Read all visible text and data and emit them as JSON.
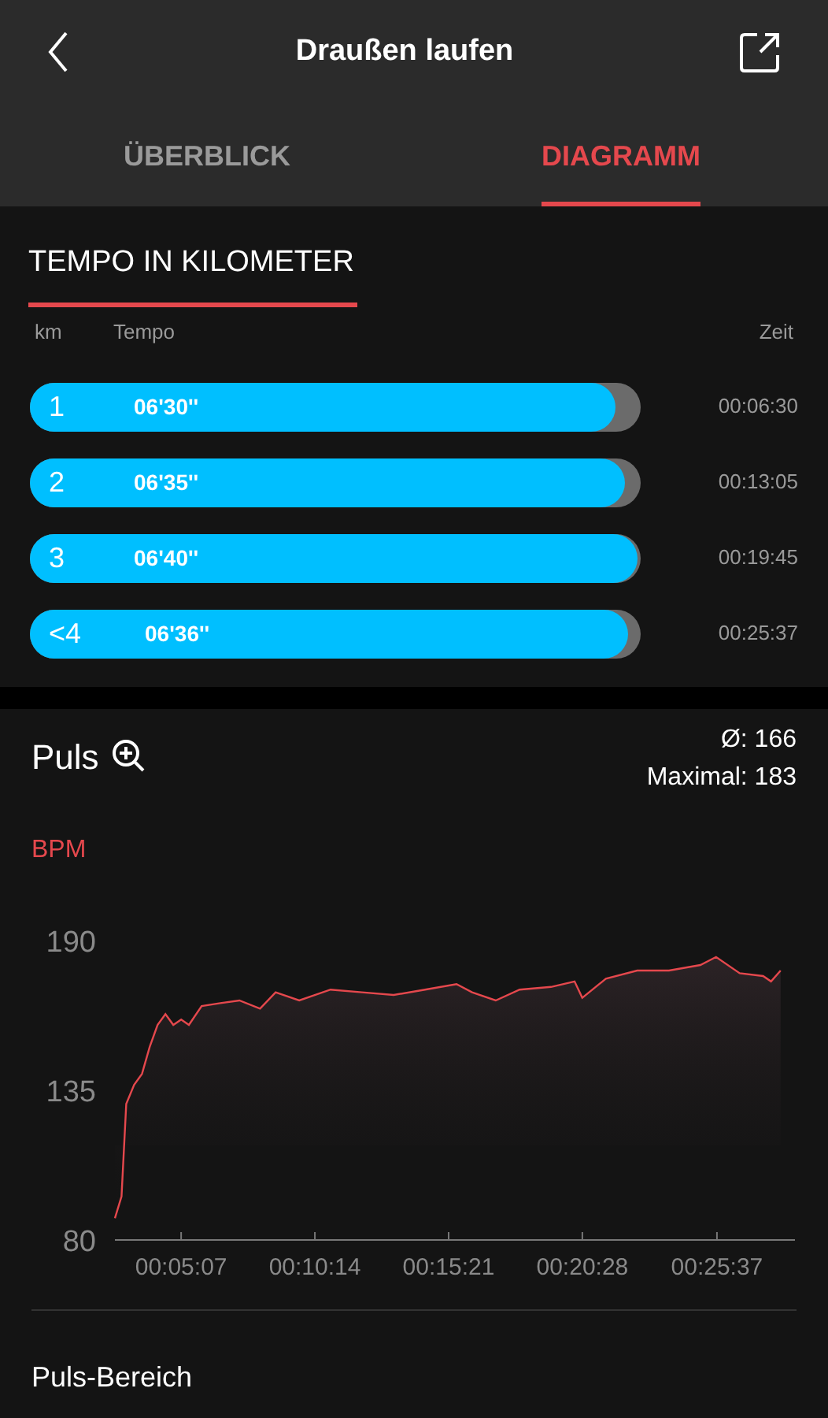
{
  "header": {
    "title": "Draußen laufen"
  },
  "tabs": [
    {
      "label": "ÜBERBLICK",
      "selected": false
    },
    {
      "label": "DIAGRAMM",
      "selected": true
    }
  ],
  "pace_section": {
    "title": "TEMPO IN KILOMETER",
    "columns": [
      "km",
      "Tempo",
      "Zeit"
    ],
    "rows": [
      {
        "km": "1",
        "pace": "06'30''",
        "time": "00:06:30",
        "level": 0.965
      },
      {
        "km": "2",
        "pace": "06'35''",
        "time": "00:13:05",
        "level": 0.98
      },
      {
        "km": "3",
        "pace": "06'40''",
        "time": "00:19:45",
        "level": 1
      },
      {
        "km": "<4",
        "pace": "06'36''",
        "time": "00:25:37",
        "level": 0.985
      }
    ]
  },
  "pulse_section": {
    "title": "Puls",
    "average": "Ø: 166",
    "maximum": "Maximal: 183",
    "chart_data": {
      "type": "area",
      "ylabel": "BPM",
      "x": [
        155,
        170,
        181,
        199,
        217,
        235,
        253,
        271,
        289,
        307,
        325,
        354,
        397,
        441,
        488,
        524,
        578,
        650,
        722,
        795,
        867,
        939,
        975,
        1029,
        1084,
        1156,
        1210,
        1228,
        1282,
        1354,
        1427,
        1499,
        1535,
        1589,
        1643,
        1661,
        1683
      ],
      "series": [
        {
          "color": "#e5484d",
          "values": [
            88,
            96,
            130,
            137,
            141,
            151,
            159,
            163,
            159,
            161,
            159,
            166,
            167,
            168,
            165,
            171,
            168,
            172,
            171,
            170,
            172,
            174,
            171,
            168,
            172,
            173,
            175,
            169,
            176,
            179,
            179,
            181,
            184,
            178,
            177,
            175,
            179
          ]
        }
      ],
      "xlim": [
        155,
        1716
      ],
      "ylim": [
        80,
        190
      ],
      "yticks": [
        80,
        135,
        190
      ],
      "xticks": [
        {
          "value": 307,
          "label": "00:05:07"
        },
        {
          "value": 614,
          "label": "00:10:14"
        },
        {
          "value": 921,
          "label": "00:15:21"
        },
        {
          "value": 1228,
          "label": "00:20:28"
        },
        {
          "value": 1537,
          "label": "00:25:37"
        }
      ]
    }
  },
  "zone_section": {
    "title": "Puls-Bereich"
  }
}
